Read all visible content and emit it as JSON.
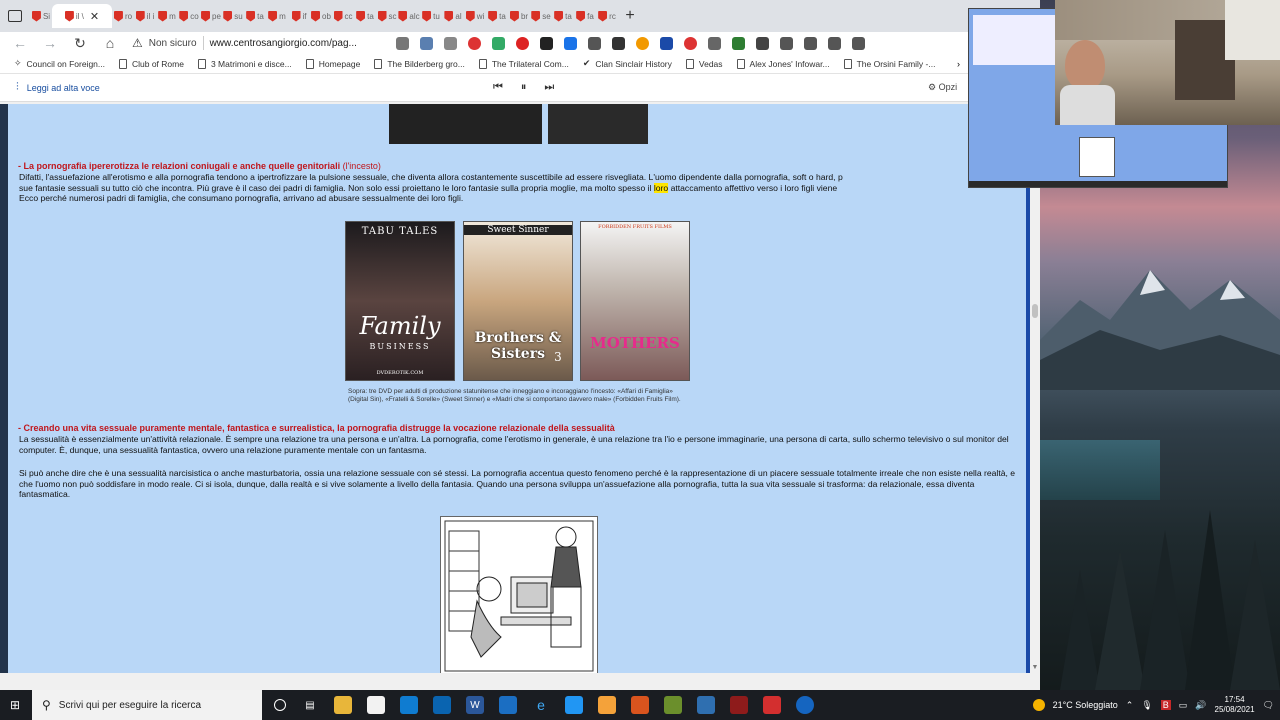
{
  "browser": {
    "tabs": [
      {
        "label": "Si",
        "active": false
      },
      {
        "label": "il \\",
        "active": true
      },
      {
        "label": "ro"
      },
      {
        "label": "il i"
      },
      {
        "label": "m"
      },
      {
        "label": "co"
      },
      {
        "label": "pe"
      },
      {
        "label": "su"
      },
      {
        "label": "ta"
      },
      {
        "label": "m"
      },
      {
        "label": "if"
      },
      {
        "label": "ob"
      },
      {
        "label": "cc"
      },
      {
        "label": "ta"
      },
      {
        "label": "sc"
      },
      {
        "label": "alc"
      },
      {
        "label": "tu"
      },
      {
        "label": "al"
      },
      {
        "label": "wi"
      },
      {
        "label": "ta"
      },
      {
        "label": "br"
      },
      {
        "label": "se"
      },
      {
        "label": "ta"
      },
      {
        "label": "fa"
      },
      {
        "label": "rc"
      }
    ],
    "active_tab_close": "✕",
    "new_tab": "+",
    "security_label": "Non sicuro",
    "url": "www.centrosangiorgio.com/pag...",
    "bookmarks": [
      "Council on Foreign...",
      "Club of Rome",
      "3 Matrimoni e disce...",
      "Homepage",
      "The Bilderberg gro...",
      "The Trilateral Com...",
      "Clan Sinclair History",
      "Vedas",
      "Alex Jones' Infowar...",
      "The Orsini Family -..."
    ],
    "read_aloud_label": "Leggi ad alta voce",
    "options_label": "Opzi"
  },
  "page": {
    "section1_heading": "- La pornografia ipererotizza le relazioni coniugali e anche quelle genitoriali",
    "section1_heading_tail": "(l'incesto)",
    "section1_lines": [
      "Difatti, l'assuefazione all'erotismo e alla pornografia tendono a ipertrofizzare la pulsione sessuale, che diventa allora costantemente suscettibile ad essere risvegliata. L'uomo dipendente dalla pornografia, soft o hard, p",
      "sue fantasie sessuali su tutto ciò che incontra. Più grave è il caso dei padri di famiglia. Non solo essi proiettano le loro fantasie sulla propria moglie, ma molto spesso il",
      "loro",
      "attaccamento affettivo verso i loro figli viene",
      "Ecco perché numerosi padri di famiglia, che consumano pornografia, arrivano ad abusare sessualmente dei loro figli."
    ],
    "dvds": [
      {
        "brand": "TABU TALES",
        "title": "Family",
        "subtitle": "BUSINESS",
        "footer": "DVDEROTIK.COM"
      },
      {
        "brand": "Sweet Sinner",
        "title": "Brothers & Sisters",
        "subtitle": "3",
        "footer": ""
      },
      {
        "brand": "FORBIDDEN FRUITS FILMS",
        "title": "MOTHERS",
        "subtitle": "",
        "footer": ""
      }
    ],
    "caption": "Sopra: tre DVD per adulti di produzione statunitense che inneggiano e incoraggiano l'incesto: «Affari di Famiglia» (Digital Sin), «Fratelli & Sorelle» (Sweet Sinner) e «Madri che si comportano davvero male» (Forbidden Fruits Film).",
    "section2_heading": "- Creando una vita sessuale puramente mentale, fantastica e surrealistica, la pornografia distrugge la vocazione relazionale della sessualità",
    "section2_p1": "La sessualità è essenzialmente un'attività relazionale. È sempre una relazione tra una persona e un'altra. La pornografia, come l'erotismo in generale, è una relazione tra l'io e persone immaginarie, una persona di carta, sullo schermo televisivo o sul monitor del computer. È, dunque, una sessualità fantastica, ovvero una relazione puramente mentale con un fantasma.",
    "section2_p2": "Si può anche dire che è una sessualità narcisistica o anche masturbatoria, ossia una relazione sessuale con sé stessi. La pornografia accentua questo fenomeno perché è la rappresentazione di un piacere sessuale totalmente irreale che non esiste nella realtà, e che l'uomo non può soddisfare in modo reale. Ci si isola, dunque, dalla realtà e si vive solamente a livello della fantasia. Quando una persona sviluppa un'assuefazione alla pornografia, tutta la sua vita sessuale si trasforma: da relazionale, essa diventa fantasmatica."
  },
  "taskbar": {
    "search_placeholder": "Scrivi qui per eseguire la ricerca",
    "weather": "21°C Soleggiato",
    "time": "17:54",
    "date": "25/08/2021"
  },
  "colors": {
    "page_bg": "#b9d7f7",
    "heading_red": "#c0171d",
    "highlight": "#ffe500"
  }
}
